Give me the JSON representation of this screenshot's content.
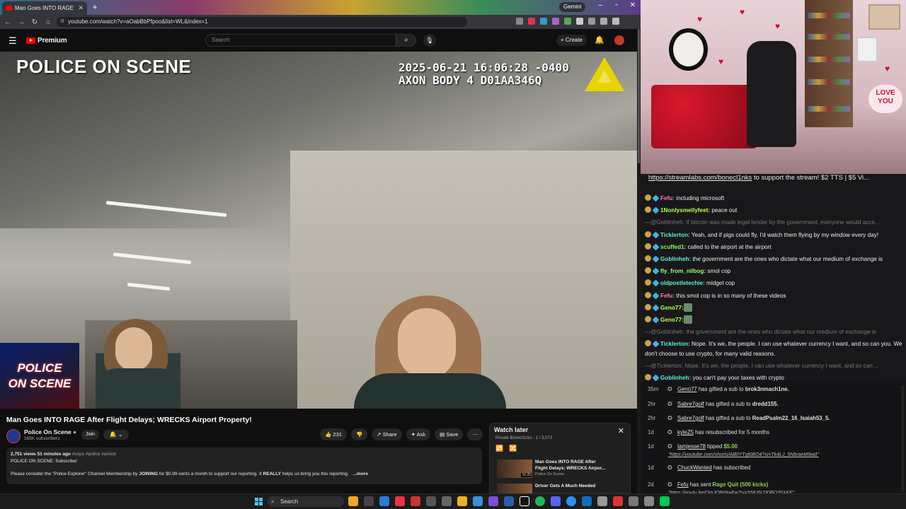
{
  "browser": {
    "tab_title": "Man Goes INTO RAGE After",
    "gemini_label": "Gemini",
    "url": "youtube.com/watch?v=aOabBbPfpoo&list=WL&index=1"
  },
  "youtube": {
    "brand": "Premium",
    "search_placeholder": "Search",
    "create_label": "Create"
  },
  "video": {
    "overlay_title": "POLICE ON SCENE",
    "timestamp_line1": "2025-06-21 16:06:28 -0400",
    "timestamp_line2": "AXON BODY 4 D01AA346Q",
    "corner_logo_line1": "POLICE",
    "corner_logo_line2": "ON SCENE"
  },
  "watch": {
    "title": "Man Goes INTO RAGE After Flight Delays; WRECKS Airport Property!",
    "channel": "Police On Scene",
    "subscribers": "185K subscribers",
    "join_label": "Join",
    "like_count": "231",
    "share_label": "Share",
    "ask_label": "Ask",
    "save_label": "Save",
    "desc_stats": "2,751 views  51 minutes ago",
    "desc_tags": "#cops #police #arrest",
    "desc_line2": "POLICE ON SCENE: Subscribe!",
    "desc_line3_a": "Please consider the \"Police Explorer\" Channel Membership by ",
    "desc_line3_b": "JOINING",
    "desc_line3_c": " for $0.99 cents a month to support our reporting. It ",
    "desc_line3_d": "REALLY",
    "desc_line3_e": " helps us bring you this reporting.",
    "desc_more": "...more"
  },
  "watch_later": {
    "title": "Watch later",
    "subtitle": "Private Bonecl1nks - 1 / 3,073",
    "items": [
      {
        "title_line1": "Man Goes INTO RAGE After",
        "title_line2": "Flight Delays; WRECKS Airpor...",
        "channel": "Police On Scene",
        "duration": "16:25"
      },
      {
        "title_line1": "Driver Gets A Much Needed",
        "title_line2": "",
        "channel": "",
        "duration": ""
      }
    ]
  },
  "stream": {
    "love_sign": "LOVE YOU"
  },
  "chat": {
    "ticker_link": "https://streamlabs.com/bonecl1nks",
    "ticker_rest": " to support the stream! $2 TTS | $5 Vi...",
    "messages": [
      {
        "user": "Fefu:",
        "text": " including microsoft",
        "color": "#ff7fa8"
      },
      {
        "user": "1Nonlysmellyfeet:",
        "text": " peace out",
        "color": "#b8ff4c"
      },
      {
        "user": "",
        "text": "—@Goblinheh: If bitcoin was made legal tender by the government, everyone would acce...",
        "color": ""
      },
      {
        "user": "Ticklerton:",
        "text": " Yeah, and if pigs could fly, I'd watch them flying by my window every day!",
        "color": "#5cf2c8"
      },
      {
        "user": "scuffed1:",
        "text": " called to the airport at the airport",
        "color": "#7aff5c"
      },
      {
        "user": "Goblinheh:",
        "text": " the government are the ones who dictate what our medium of exchange is",
        "color": "#5cf2c8"
      },
      {
        "user": "fly_from_nilbog:",
        "text": " smol cop",
        "color": "#9cff6a"
      },
      {
        "user": "oldpostletechie:",
        "text": " midget cop",
        "color": "#5cf2c8"
      },
      {
        "user": "Fefu:",
        "text": " this smol cop is in so many of these videos",
        "color": "#ff7fa8"
      },
      {
        "user": "Geno77:",
        "text": "",
        "color": "#b8ff4c"
      },
      {
        "user": "Geno77:",
        "text": "",
        "color": "#b8ff4c"
      },
      {
        "user": "",
        "text": "—@Goblinheh: the government are the ones who dictate what our medium of exchange is",
        "color": ""
      },
      {
        "user": "Ticklerton:",
        "text": " Nope. It's we, the people. I can use whatever currency I want, and so can you. We don't choose to use crypto, for many valid reasons.",
        "color": "#5cf2c8"
      },
      {
        "user": "",
        "text": "—@Ticklerton: Nope. It's we, the people. I can use whatever currency I want, and so can ...",
        "color": ""
      },
      {
        "user": "Goblinheh:",
        "text": " you can't pay your taxes with crypto",
        "color": "#5cf2c8"
      }
    ]
  },
  "events": [
    {
      "time": "35m",
      "name": "Geno77",
      "text": " has gifted a sub to ",
      "target": "brok3nmach1ne."
    },
    {
      "time": "2hr",
      "name": "Sabre7golf",
      "text": " has gifted a sub to ",
      "target": "dredd155."
    },
    {
      "time": "2hr",
      "name": "Sabre7golf",
      "text": " has gifted a sub to ",
      "target": "ReadPsalm22_16_Isaiah53_5."
    },
    {
      "time": "1d",
      "name": "kyleZ5",
      "text": " has resubscribed for 5 months",
      "target": ""
    },
    {
      "time": "1d",
      "name": "Iamjesse78",
      "text": " tipped ",
      "target": "$5.00",
      "link": "\"https://youtube.com/shorts/AB0YTgt0BO4?si=Tk4LJ_5NbraeM9wd\""
    },
    {
      "time": "1d",
      "name": "ChuckWanted",
      "text": " has subscribed",
      "target": ""
    },
    {
      "time": "2d",
      "name": "Fefu",
      "text": " has sent ",
      "target": "Rage Quit (500 kicks)",
      "link": "\"https://youtu.be/QmJOBj9jwFw?si=558J6IJ30BQ35XKE\""
    }
  ],
  "taskbar": {
    "search_label": "Search"
  }
}
